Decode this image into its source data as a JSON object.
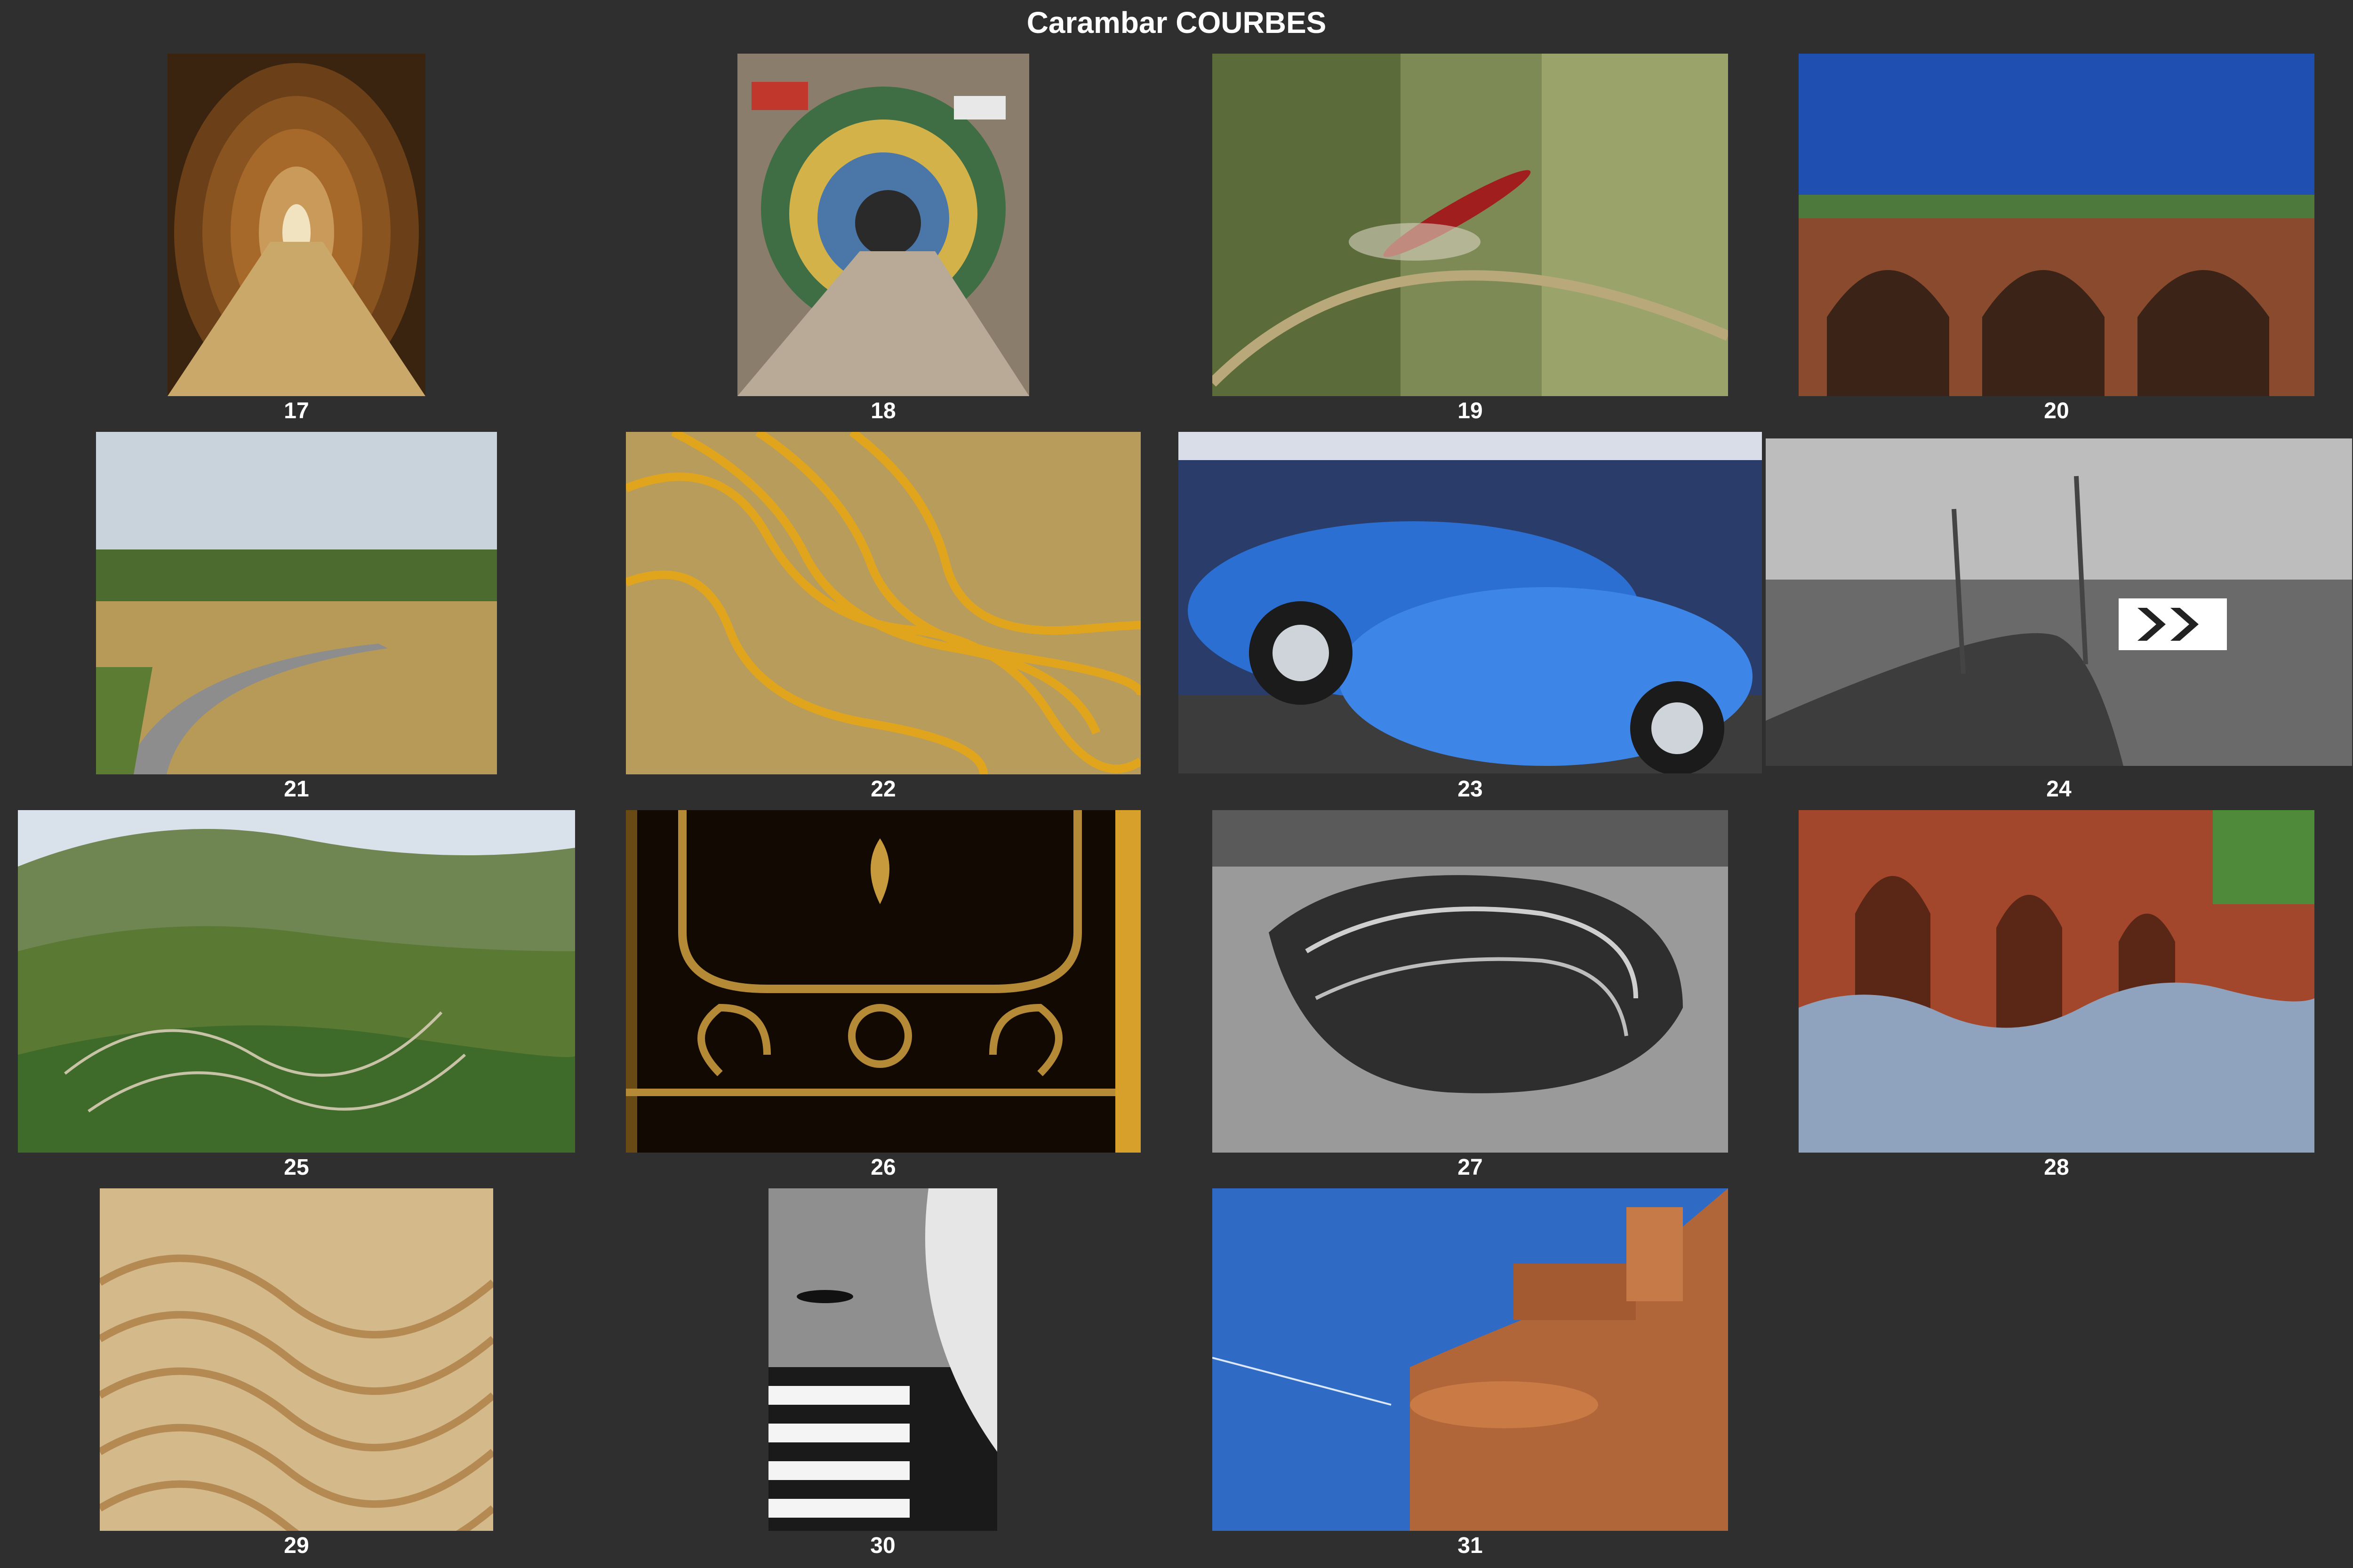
{
  "title": "Carambar COURBES",
  "photos": [
    {
      "number": "17",
      "subject": "tunnel-corridor-icon"
    },
    {
      "number": "18",
      "subject": "graffiti-tunnel-icon"
    },
    {
      "number": "19",
      "subject": "red-dragonfly-icon"
    },
    {
      "number": "20",
      "subject": "ruined-arches-icon"
    },
    {
      "number": "21",
      "subject": "curving-country-road-icon"
    },
    {
      "number": "22",
      "subject": "wavy-golden-lines-icon"
    },
    {
      "number": "23",
      "subject": "blue-vintage-cars-icon"
    },
    {
      "number": "24",
      "subject": "road-chevron-sign-icon"
    },
    {
      "number": "25",
      "subject": "terraced-vineyard-hills-icon"
    },
    {
      "number": "26",
      "subject": "ornate-iron-gate-icon"
    },
    {
      "number": "27",
      "subject": "black-white-rock-icon"
    },
    {
      "number": "28",
      "subject": "brick-arches-wave-roof-icon"
    },
    {
      "number": "29",
      "subject": "sand-ripples-icon"
    },
    {
      "number": "30",
      "subject": "abstract-stairs-icon"
    },
    {
      "number": "31",
      "subject": "brick-tower-icon"
    }
  ],
  "colors": {
    "background": "#2f2f2f",
    "text": "#ffffff"
  }
}
